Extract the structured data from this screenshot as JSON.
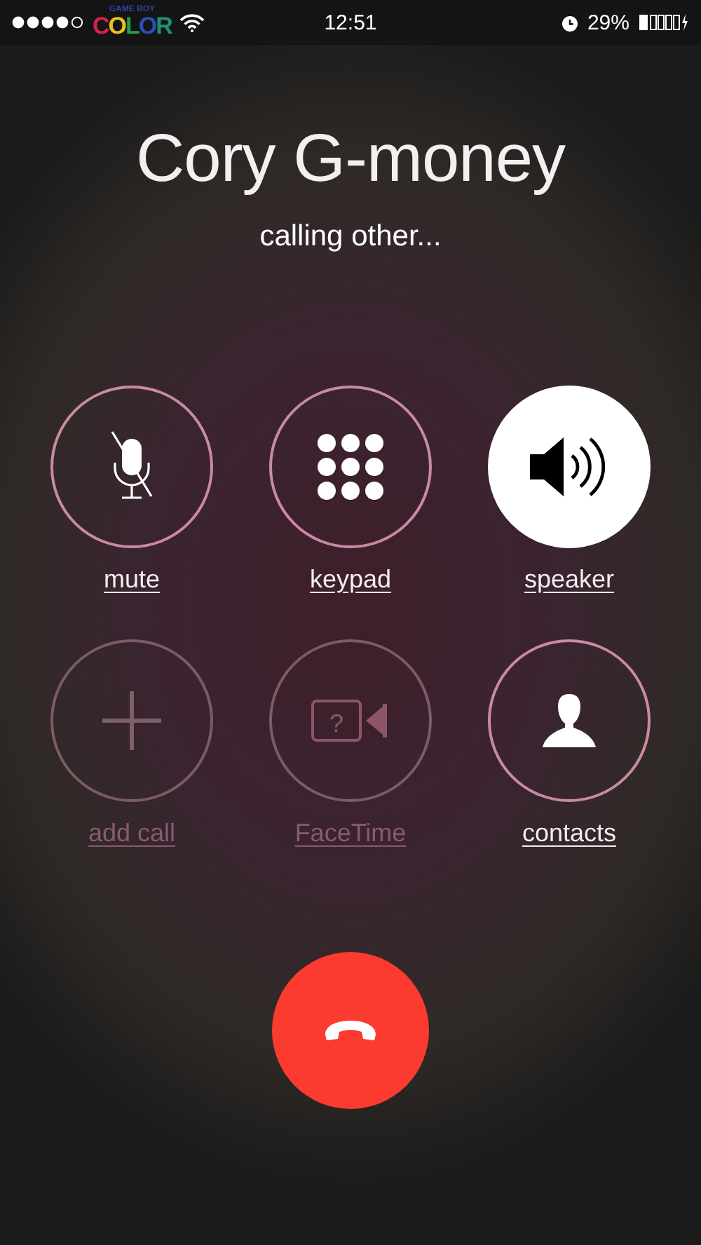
{
  "status_bar": {
    "carrier": {
      "top": "GAME BOY",
      "letters": [
        {
          "char": "C",
          "color": "#d8204c"
        },
        {
          "char": "O",
          "color": "#e8c020"
        },
        {
          "char": "L",
          "color": "#2a9a4a"
        },
        {
          "char": "O",
          "color": "#2a50b8"
        },
        {
          "char": "R",
          "color": "#20907a"
        }
      ]
    },
    "time": "12:51",
    "battery": "29%"
  },
  "caller": {
    "name": "Cory G-money",
    "status": "calling other..."
  },
  "buttons": [
    {
      "kind": "mute",
      "label": "mute",
      "selected": false,
      "disabled": false
    },
    {
      "kind": "keypad",
      "label": "keypad",
      "selected": false,
      "disabled": false
    },
    {
      "kind": "speaker",
      "label": "speaker",
      "selected": true,
      "disabled": false
    },
    {
      "kind": "add",
      "label": "add call",
      "selected": false,
      "disabled": true
    },
    {
      "kind": "facetime",
      "icon_text": "?",
      "label": "FaceTime",
      "selected": false,
      "disabled": true
    },
    {
      "kind": "contacts",
      "label": "contacts",
      "selected": false,
      "disabled": false
    }
  ]
}
